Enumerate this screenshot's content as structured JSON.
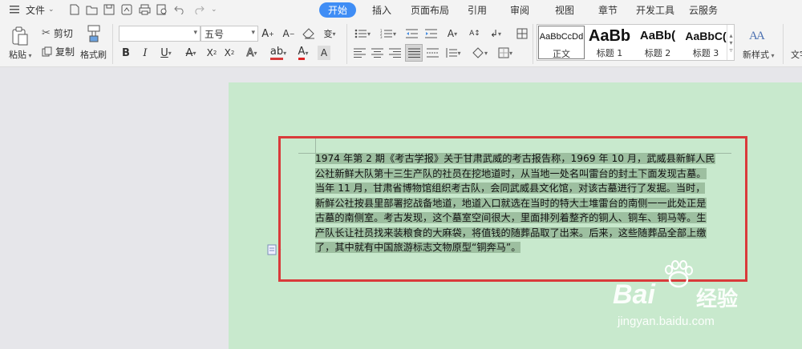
{
  "menubar": {
    "file_label": "文件",
    "tabs": [
      {
        "label": "开始"
      },
      {
        "label": "插入"
      },
      {
        "label": "页面布局"
      },
      {
        "label": "引用"
      },
      {
        "label": "审阅"
      },
      {
        "label": "视图"
      },
      {
        "label": "章节"
      },
      {
        "label": "开发工具"
      },
      {
        "label": "云服务"
      }
    ]
  },
  "ribbon": {
    "paste_label": "粘贴",
    "cut_label": "剪切",
    "copy_label": "复制",
    "format_painter_label": "格式刷",
    "font_name": "",
    "font_size": "五号",
    "styles": [
      {
        "sample": "AaBbCcDd",
        "name": "正文"
      },
      {
        "sample": "AaBb",
        "name": "标题 1"
      },
      {
        "sample": "AaBb(",
        "name": "标题 2"
      },
      {
        "sample": "AaBbC(",
        "name": "标题 3"
      }
    ],
    "new_style_label": "新样式",
    "text_tools_label": "文字"
  },
  "document": {
    "paragraph_lines": [
      "1974 年第 2 期《考古学报》关于甘肃武威的考古报告称，1969 年 10 月，武威县新鲜人民",
      "公社新鲜大队第十三生产队的社员在挖地道时，从当地一处名叫雷台的封土下面发现古墓。",
      "当年 11 月，甘肃省博物馆组织考古队，会同武威县文化馆，对该古墓进行了发掘。当时，",
      "新鲜公社按县里部署挖战备地道，地道入口就选在当时的特大土堆雷台的南侧一一此处正是",
      "古墓的南侧室。考古发现，这个墓室空间很大，里面排列着整齐的铜人、铜车、铜马等。生",
      "产队长让社员找来装粮食的大麻袋，将值钱的随葬品取了出来。后来，这些随葬品全部上缴",
      "了，其中就有中国旅游标志文物原型“铜奔马”。"
    ]
  },
  "watermark": {
    "brand": "Bai",
    "brand2": "经验",
    "url": "jingyan.baidu.com"
  }
}
